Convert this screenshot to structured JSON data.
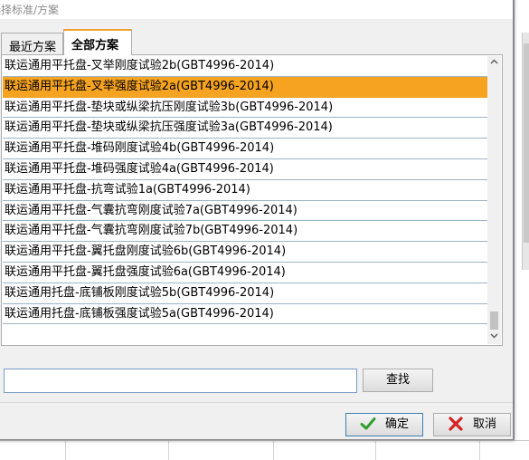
{
  "dialog": {
    "title": "选择标准/方案"
  },
  "tabs": [
    {
      "label": "最近方案",
      "active": false
    },
    {
      "label": "全部方案",
      "active": true
    }
  ],
  "list": {
    "items": [
      "联运通用平托盘-叉举刚度试验2b(GBT4996-2014)",
      "联运通用平托盘-叉举强度试验2a(GBT4996-2014)",
      "联运通用平托盘-垫块或纵梁抗压刚度试验3b(GBT4996-2014)",
      "联运通用平托盘-垫块或纵梁抗压强度试验3a(GBT4996-2014)",
      "联运通用平托盘-堆码刚度试验4b(GBT4996-2014)",
      "联运通用平托盘-堆码强度试验4a(GBT4996-2014)",
      "联运通用平托盘-抗弯试验1a(GBT4996-2014)",
      "联运通用平托盘-气囊抗弯刚度试验7a(GBT4996-2014)",
      "联运通用平托盘-气囊抗弯刚度试验7b(GBT4996-2014)",
      "联运通用平托盘-翼托盘刚度试验6b(GBT4996-2014)",
      "联运通用平托盘-翼托盘强度试验6a(GBT4996-2014)",
      "联运通用托盘-底铺板刚度试验5b(GBT4996-2014)",
      "联运通用托盘-底铺板强度试验5a(GBT4996-2014)"
    ],
    "selected_index": 1,
    "selected_color": "#f5a320"
  },
  "search": {
    "value": "",
    "placeholder": "",
    "button_label": "查找"
  },
  "buttons": {
    "ok_label": "确定",
    "ok_icon": "check-icon",
    "cancel_label": "取消",
    "cancel_icon": "x-icon"
  }
}
